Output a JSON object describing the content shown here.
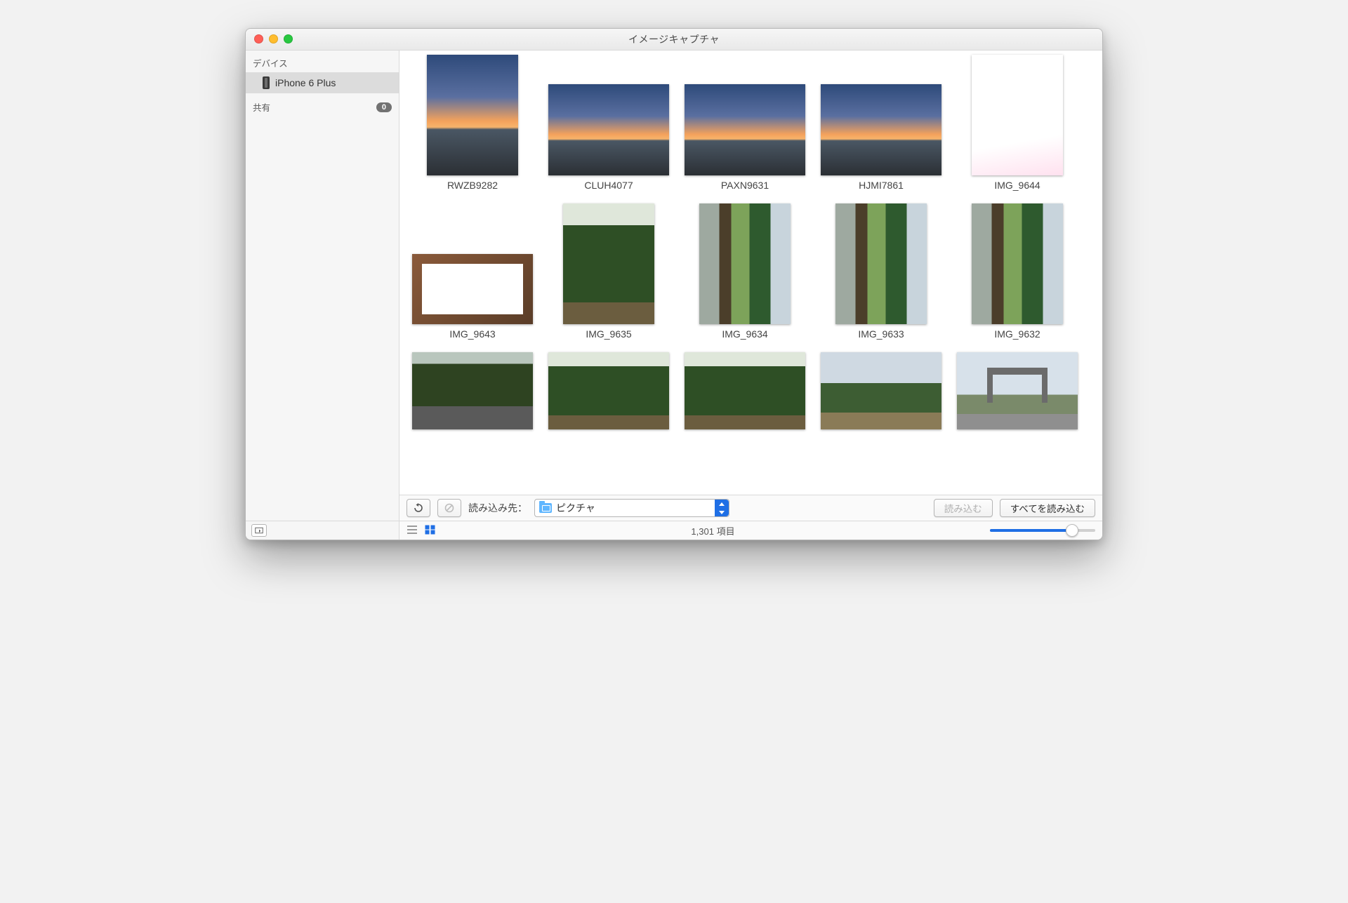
{
  "window": {
    "title": "イメージキャプチャ"
  },
  "sidebar": {
    "devices_label": "デバイス",
    "shared_label": "共有",
    "shared_badge": "0",
    "device_name": "iPhone 6 Plus"
  },
  "thumbnails": {
    "row1": [
      {
        "name": "RWZB9282",
        "shape": "portrait",
        "img": "sunset"
      },
      {
        "name": "CLUH4077",
        "shape": "landscape",
        "img": "sunset"
      },
      {
        "name": "PAXN9631",
        "shape": "landscape",
        "img": "sunset"
      },
      {
        "name": "HJMI7861",
        "shape": "landscape",
        "img": "sunset"
      },
      {
        "name": "IMG_9644",
        "shape": "portrait",
        "img": "pinkboard"
      }
    ],
    "row2": [
      {
        "name": "IMG_9643",
        "shape": "landscapeS",
        "img": "sign"
      },
      {
        "name": "IMG_9635",
        "shape": "portrait",
        "img": "forest"
      },
      {
        "name": "IMG_9634",
        "shape": "portrait",
        "img": "shrine"
      },
      {
        "name": "IMG_9633",
        "shape": "portrait",
        "img": "shrine"
      },
      {
        "name": "IMG_9632",
        "shape": "portrait",
        "img": "shrine"
      }
    ],
    "row3": [
      {
        "name": "",
        "shape": "partial",
        "img": "stone"
      },
      {
        "name": "",
        "shape": "partial",
        "img": "forest"
      },
      {
        "name": "",
        "shape": "partial",
        "img": "forest"
      },
      {
        "name": "",
        "shape": "partial",
        "img": "shrine2"
      },
      {
        "name": "",
        "shape": "partial",
        "img": "gate"
      }
    ]
  },
  "toolbar": {
    "import_to_label": "読み込み先：",
    "dest_folder": "ピクチャ",
    "import_label": "読み込む",
    "import_all_label": "すべてを読み込む"
  },
  "status": {
    "count_text": "1,301 項目"
  }
}
